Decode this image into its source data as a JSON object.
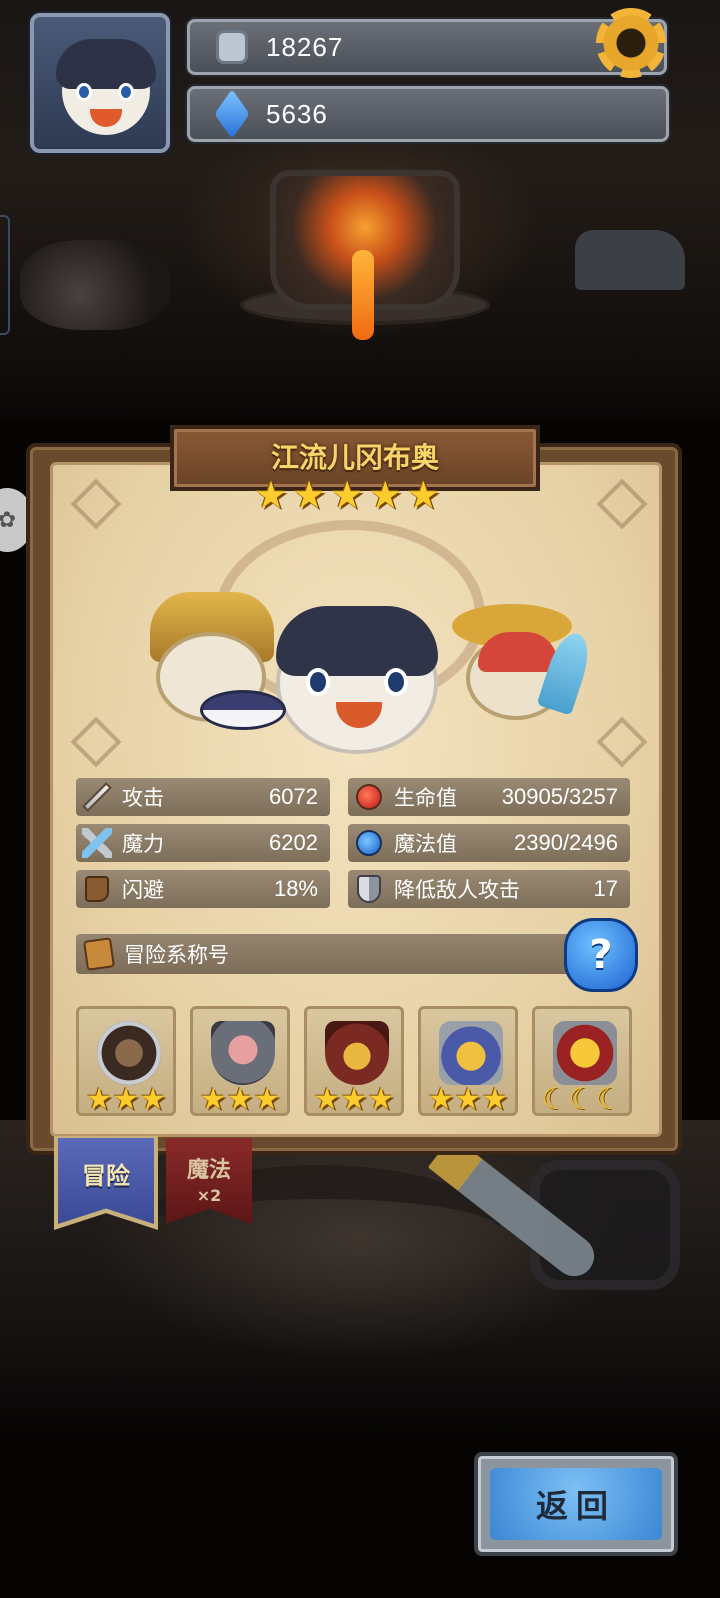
{
  "hud": {
    "coins": "18267",
    "gems": "5636",
    "coin_icon": "coin-icon",
    "gem_icon": "gem-icon",
    "settings_icon": "gear-icon"
  },
  "hero_card": {
    "name": "江流儿冈布奥",
    "stars": 5,
    "stats": [
      {
        "label": "攻击",
        "value": "6072",
        "icon": "sword-icon"
      },
      {
        "label": "生命值",
        "value": "30905/3257",
        "icon": "red-potion-icon"
      },
      {
        "label": "魔力",
        "value": "6202",
        "icon": "staff-icon"
      },
      {
        "label": "魔法值",
        "value": "2390/2496",
        "icon": "blue-potion-icon"
      },
      {
        "label": "闪避",
        "value": "18%",
        "icon": "boot-icon"
      },
      {
        "label": "降低敌人攻击",
        "value": "17",
        "icon": "shield-icon"
      }
    ],
    "title_section": {
      "label": "冒险系称号",
      "help": "?"
    },
    "badges": [
      {
        "name": "telescope-badge",
        "stars": 3,
        "type": "star"
      },
      {
        "name": "shield-badge",
        "stars": 3,
        "type": "star"
      },
      {
        "name": "treasure-badge",
        "stars": 3,
        "type": "star"
      },
      {
        "name": "laurel-badge",
        "stars": 3,
        "type": "star"
      },
      {
        "name": "trophy-badge",
        "stars": 3,
        "type": "moon"
      }
    ]
  },
  "tabs": {
    "adventure": "冒险",
    "magic": "魔法",
    "magic_multiplier": "×2"
  },
  "back_button": "返回",
  "colors": {
    "star": "#ffcc2e",
    "title_gold": "#f7d56a",
    "button_blue": "#3b86d4",
    "panel_parchment": "#e8d3a8"
  }
}
